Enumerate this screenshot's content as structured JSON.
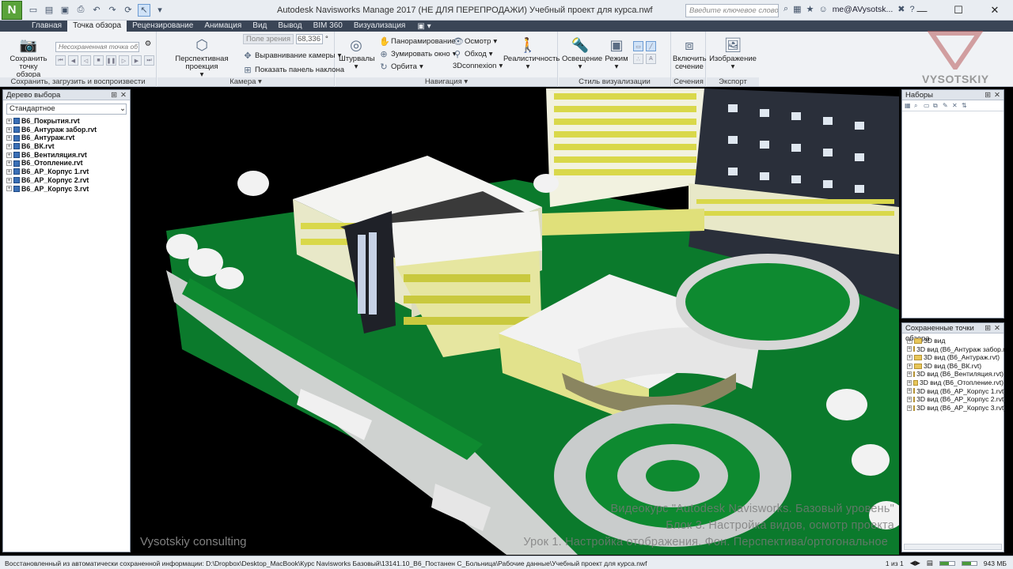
{
  "titlebar": {
    "app_letter": "N",
    "title": "Autodesk Navisworks Manage 2017 (НЕ ДЛЯ ПЕРЕПРОДАЖИ)   Учебный проект для курса.nwf",
    "search_placeholder": "Введите ключевое слово/фразу",
    "user": "me@AVysotsk...",
    "help": "?",
    "minimize": "—",
    "maximize": "☐",
    "close": "✕"
  },
  "tabs": [
    "Главная",
    "Точка обзора",
    "Рецензирование",
    "Анимация",
    "Вид",
    "Вывод",
    "BIM 360",
    "Визуализация"
  ],
  "active_tab": "Точка обзора",
  "ribbon": {
    "save_vp": {
      "label1": "Сохранить",
      "label2": "точку обзора",
      "unsaved_placeholder": "Несохраненная точка об",
      "group_label": "Сохранить, загрузить и воспроизвести"
    },
    "camera": {
      "perspective": "Перспективная проекция",
      "fov_label": "Поле зрения",
      "fov_value": "68,336",
      "fov_unit": "°",
      "align": "Выравнивание камеры",
      "tilt": "Показать панель наклона",
      "group_label": "Камера"
    },
    "navigation": {
      "wheels": "Штурвалы",
      "pan": "Панорамирование",
      "zoom": "Зумировать окно",
      "orbit": "Орбита",
      "look": "Осмотр",
      "walk": "Обход",
      "connexion": "3Dconnexion",
      "realism": "Реалистичность",
      "group_label": "Навигация"
    },
    "render_style": {
      "lighting": "Освещение",
      "mode": "Режим",
      "group_label": "Стиль визуализации"
    },
    "sections": {
      "enable": "Включить",
      "sectioning": "сечение",
      "group_label": "Сечения"
    },
    "export": {
      "image": "Изображение",
      "group_label": "Экспорт"
    }
  },
  "selection_tree": {
    "title": "Дерево выбора",
    "mode": "Стандартное",
    "items": [
      "В6_Покрытия.rvt",
      "В6_Антураж забор.rvt",
      "В6_Антураж.rvt",
      "В6_ВК.rvt",
      "В6_Вентиляция.rvt",
      "В6_Отопление.rvt",
      "В6_АР_Корпус 1.rvt",
      "В6_АР_Корпус 2.rvt",
      "В6_АР_Корпус 3.rvt"
    ]
  },
  "sets_panel": {
    "title": "Наборы"
  },
  "saved_viewpoints": {
    "title": "Сохраненные точки обзора",
    "items": [
      "3D вид",
      "3D вид (В6_Антураж забор.r",
      "3D вид (В6_Антураж.rvt)",
      "3D вид (В6_ВК.rvt)",
      "3D вид (В6_Вентиляция.rvt)",
      "3D вид (В6_Отопление.rvt)",
      "3D вид (В6_АР_Корпус 1.rvt)",
      "3D вид (В6_АР_Корпус 2.rvt)",
      "3D вид (В6_АР_Корпус 3.rvt)"
    ]
  },
  "overlay": {
    "line1": "Видеокурс \"Autodesk Navisworks. Базовый уровень\"",
    "line2": "Блок 3. Настройка видов, осмотр проекта",
    "line3": "Урок 1. Настройка отображения. Фон. Перспектива/ортогональное",
    "left_watermark": "Vysotskiy consulting",
    "brand": "VYSOTSKIY"
  },
  "statusbar": {
    "text": "Восстановленный из автоматически сохраненной информации: D:\\Dropbox\\Desktop_MacBook\\Курс Navisworks Базовый\\13141.10_В6_Постанен С_Больница\\Рабочие данные\\Учебный проект для курса.nwf",
    "page": "1 из 1",
    "memory": "943 МБ"
  },
  "colors": {
    "accent": "#5aa33a",
    "tabbar": "#3a4556",
    "facade_yellow": "#e6e65a",
    "grass": "#0d7a2a"
  }
}
